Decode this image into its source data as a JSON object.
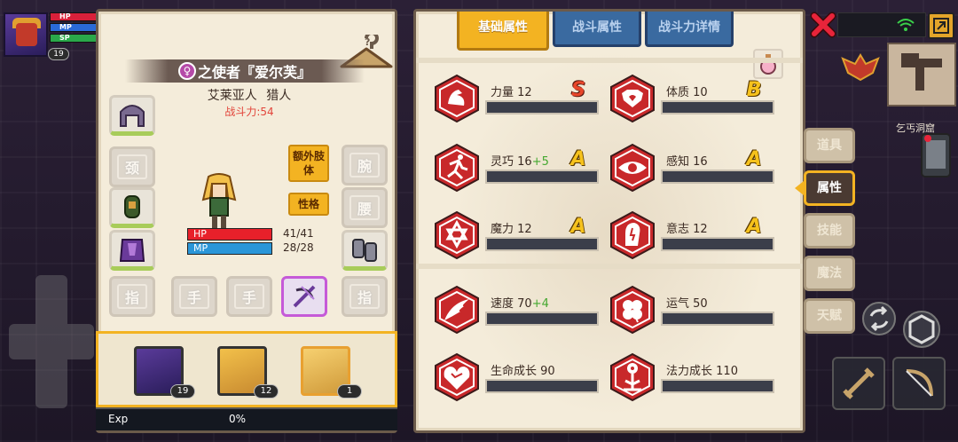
{
  "mini_status": {
    "hp_label": "HP",
    "mp_label": "MP",
    "sp_label": "SP",
    "level": "19"
  },
  "character": {
    "gender_symbol": "♀",
    "name": "之使者『爱尔芙』",
    "race": "艾莱亚人",
    "class": "猎人",
    "power_label": "战斗力:54",
    "hp_label": "HP",
    "hp_value": "41/41",
    "mp_label": "MP",
    "mp_value": "28/28",
    "extra_limb_label": "额外肢体",
    "personality_label": "性格"
  },
  "equipment_slots": {
    "neck": "颈",
    "wrist": "腕",
    "waist": "腰",
    "finger_left": "指",
    "hand_left": "手",
    "hand_right": "手",
    "finger_right": "指"
  },
  "party": [
    {
      "level": "19"
    },
    {
      "level": "12"
    },
    {
      "level": "1"
    }
  ],
  "exp": {
    "label": "Exp",
    "value": "0%"
  },
  "tabs": {
    "basic": "基础属性",
    "combat": "战斗属性",
    "power_detail": "战斗力详情"
  },
  "attributes": [
    {
      "name": "力量",
      "value": "12",
      "bonus": "",
      "grade": "S"
    },
    {
      "name": "体质",
      "value": "10",
      "bonus": "",
      "grade": "B"
    },
    {
      "name": "灵巧",
      "value": "16",
      "bonus": "+5",
      "grade": "A"
    },
    {
      "name": "感知",
      "value": "16",
      "bonus": "",
      "grade": "A"
    },
    {
      "name": "魔力",
      "value": "12",
      "bonus": "",
      "grade": "A"
    },
    {
      "name": "意志",
      "value": "12",
      "bonus": "",
      "grade": "A"
    },
    {
      "name": "速度",
      "value": "70",
      "bonus": "+4",
      "grade": ""
    },
    {
      "name": "运气",
      "value": "50",
      "bonus": "",
      "grade": ""
    },
    {
      "name": "生命成长",
      "value": "90",
      "bonus": "",
      "grade": ""
    },
    {
      "name": "法力成长",
      "value": "110",
      "bonus": "",
      "grade": ""
    }
  ],
  "side_tabs": {
    "items": "道具",
    "attributes": "属性",
    "skills": "技能",
    "magic": "魔法",
    "talent": "天赋"
  },
  "hud": {
    "location": "乞丐洞窟"
  },
  "colors": {
    "accent": "#f3b322",
    "panel": "#f4ecda",
    "tab_blue": "#3a6aa0",
    "attr_red": "#c8282a"
  }
}
